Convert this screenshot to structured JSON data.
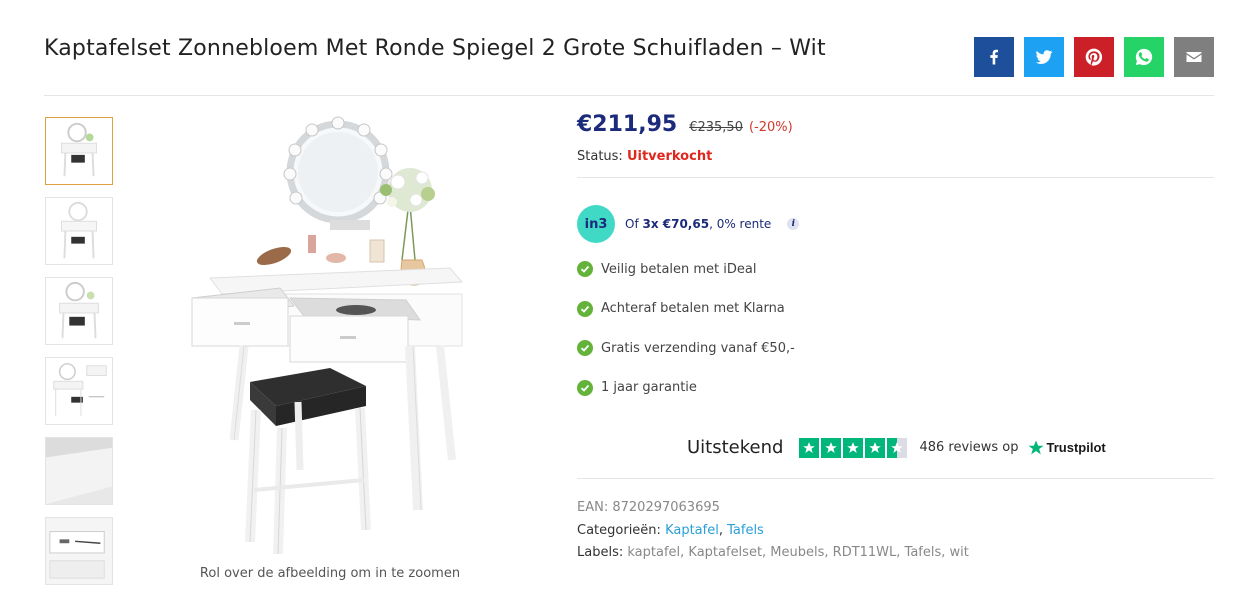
{
  "product": {
    "title": "Kaptafelset Zonnebloem Met Ronde Spiegel 2 Grote Schuifladen – Wit",
    "price": "€211,95",
    "old_price": "€235,50",
    "discount": "(-20%)",
    "status_label": "Status:",
    "status_value": "Uitverkocht"
  },
  "share": [
    {
      "name": "facebook",
      "icon": "facebook-icon",
      "color": "#1d4f9a"
    },
    {
      "name": "twitter",
      "icon": "twitter-icon",
      "color": "#1da1f2"
    },
    {
      "name": "pinterest",
      "icon": "pinterest-icon",
      "color": "#cb2027"
    },
    {
      "name": "whatsapp",
      "icon": "whatsapp-icon",
      "color": "#25d366"
    },
    {
      "name": "email",
      "icon": "mail-icon",
      "color": "#7f7f7f"
    }
  ],
  "gallery": {
    "zoom_hint": "Rol over de afbeelding om in te zoomen",
    "thumb_count": 6
  },
  "in3": {
    "logo": "in3",
    "prefix": "Of ",
    "installment": "3x €70,65",
    "suffix": ", 0% rente",
    "info": "i"
  },
  "usps": [
    "Veilig betalen met iDeal",
    "Achteraf betalen met Klarna",
    "Gratis verzending vanaf €50,-",
    "1 jaar garantie"
  ],
  "trustpilot": {
    "rating_label": "Uitstekend",
    "stars": 4.5,
    "reviews": "486 reviews op",
    "brand": "Trustpilot"
  },
  "meta": {
    "ean_label": "EAN:",
    "ean": "8720297063695",
    "categories_label": "Categorieën:",
    "categories": [
      "Kaptafel",
      "Tafels"
    ],
    "labels_label": "Labels:",
    "labels": "kaptafel, Kaptafelset, Meubels, RDT11WL, Tafels, wit"
  },
  "colors": {
    "price": "#1b2a7a",
    "status": "#e0271d",
    "discount": "#d0392b",
    "link": "#2a9fd6",
    "check": "#63b33a",
    "trustpilot": "#00b67a",
    "in3": "#3fd9c6"
  }
}
